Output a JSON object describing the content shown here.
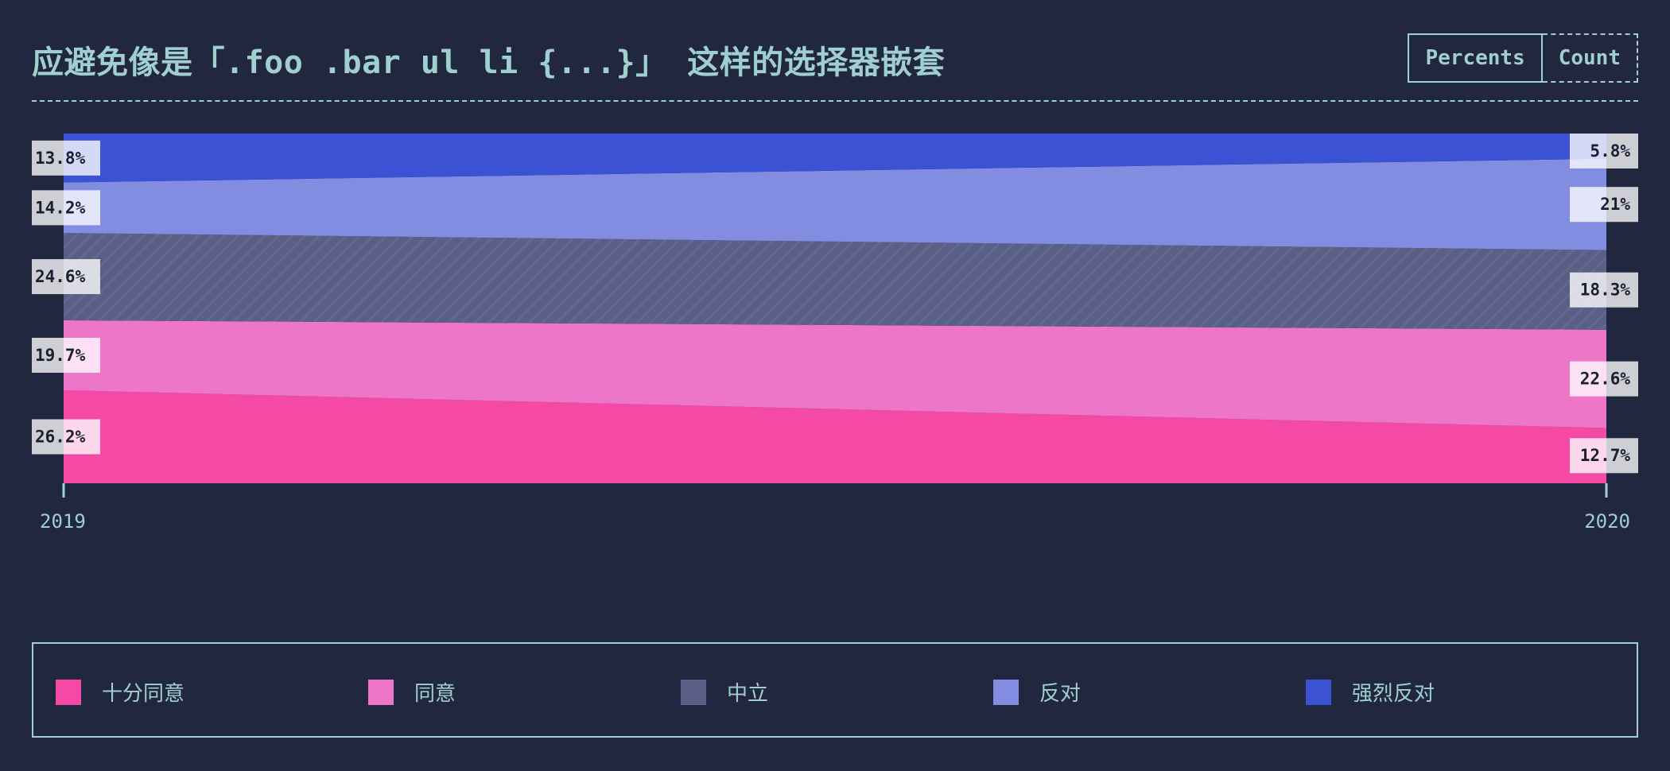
{
  "header": {
    "title": "应避免像是「.foo .bar ul li {...}」 这样的选择器嵌套",
    "toggle": [
      {
        "label": "Percents",
        "active": true
      },
      {
        "label": "Count",
        "active": false
      }
    ]
  },
  "chart_data": {
    "type": "area",
    "stacked": true,
    "normalized": true,
    "categories": [
      "2019",
      "2020"
    ],
    "series": [
      {
        "name": "十分同意",
        "values": [
          26.2,
          12.7
        ],
        "labels": [
          "26.2%",
          "12.7%"
        ],
        "color": "#f449a4"
      },
      {
        "name": "同意",
        "values": [
          19.7,
          22.6
        ],
        "labels": [
          "19.7%",
          "22.6%"
        ],
        "color": "#ee76c9"
      },
      {
        "name": "中立",
        "values": [
          24.6,
          18.3
        ],
        "labels": [
          "24.6%",
          "18.3%"
        ],
        "color": "#5a5f85"
      },
      {
        "name": "反对",
        "values": [
          14.2,
          21
        ],
        "labels": [
          "14.2%",
          "21%"
        ],
        "color": "#828de2"
      },
      {
        "name": "强烈反对",
        "values": [
          13.8,
          5.8
        ],
        "labels": [
          "13.8%",
          "5.8%"
        ],
        "color": "#3c52d4"
      }
    ],
    "legend_position": "bottom"
  },
  "legend": {
    "items": [
      {
        "label": "十分同意",
        "color": "#f449a4"
      },
      {
        "label": "同意",
        "color": "#ee76c9"
      },
      {
        "label": "中立",
        "color": "#5a5f85"
      },
      {
        "label": "反对",
        "color": "#828de2"
      },
      {
        "label": "强烈反对",
        "color": "#3c52d4"
      }
    ]
  }
}
